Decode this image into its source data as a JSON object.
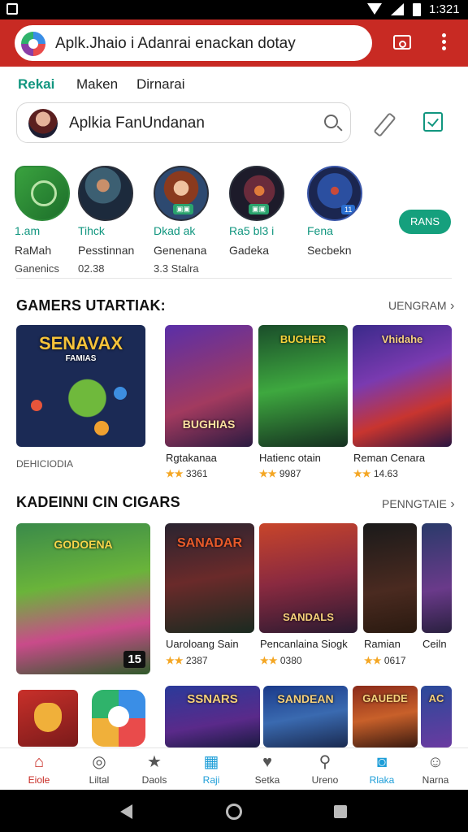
{
  "status_bar": {
    "time": "1:321"
  },
  "top_bar": {
    "url_text": "Aplk.Jhaio i Adanrai enackan dotay"
  },
  "tabs": [
    {
      "label": "Rekai",
      "active": true
    },
    {
      "label": "Maken",
      "active": false
    },
    {
      "label": "Dirnarai",
      "active": false
    }
  ],
  "search": {
    "value": "Aplkia FanUndanan"
  },
  "stories": [
    {
      "l1": "1.am",
      "l2": "RaMah",
      "l3": "Ganenics"
    },
    {
      "l1": "Tihck",
      "l2": "Pesstinnan",
      "l3": "02.38"
    },
    {
      "l1": "Dkad ak",
      "l2": "Genenana",
      "l3": "3.3 Stalra"
    },
    {
      "l1": "Ra5 bl3 i",
      "l2": "Gadeka",
      "l3": ""
    },
    {
      "l1": "Fena",
      "l2": "Secbekn",
      "l3": ""
    }
  ],
  "more_button": "RANS",
  "section1": {
    "title": "GAMERS UTARTIAK:",
    "link": "UENGRAM",
    "feature": {
      "title": "SENAVAX",
      "subtitle": "FAMIAS",
      "caption": "DEHICIODIA"
    },
    "items": [
      {
        "poster_title": "BUGHIAS",
        "name": "Rgtakanaa",
        "rating": "3361"
      },
      {
        "poster_title": "BUGHER",
        "name": "Hatienc otain",
        "rating": "9987"
      },
      {
        "poster_title": "Vhidahe",
        "name": "Reman Cenara",
        "rating": "14.63"
      }
    ]
  },
  "section2": {
    "title": "KADEINNI CIN CIGARS",
    "link": "PENNGTAIE",
    "feature": {
      "title": "GODOENA",
      "age": "15"
    },
    "items": [
      {
        "poster_title": "SANADAR",
        "name": "Uaroloang Sain",
        "rating": "2387"
      },
      {
        "poster_title": "SANDALS",
        "name": "Pencanlaina Siogk",
        "rating": "0380"
      },
      {
        "poster_title": "",
        "name": "Ramian",
        "rating": "0617"
      },
      {
        "poster_title": "",
        "name": "Ceiln",
        "rating": ""
      }
    ]
  },
  "section3": {
    "posters": [
      "SSNARS",
      "SANDEAN",
      "GAUEDE",
      "AC"
    ]
  },
  "bottom_nav": [
    {
      "label": "Eiole",
      "icon": "home-icon"
    },
    {
      "label": "Liltal",
      "icon": "gamepad-icon"
    },
    {
      "label": "Daols",
      "icon": "star-icon"
    },
    {
      "label": "Raji",
      "icon": "calendar-icon"
    },
    {
      "label": "Setka",
      "icon": "heart-icon"
    },
    {
      "label": "Ureno",
      "icon": "search-icon"
    },
    {
      "label": "Rlaka",
      "icon": "chat-icon"
    },
    {
      "label": "Narna",
      "icon": "profile-icon"
    }
  ],
  "colors": {
    "accent": "#11967f",
    "topbar": "#c82a23",
    "nav_active": "#1e9ed8",
    "rating_star": "#f4a623"
  }
}
